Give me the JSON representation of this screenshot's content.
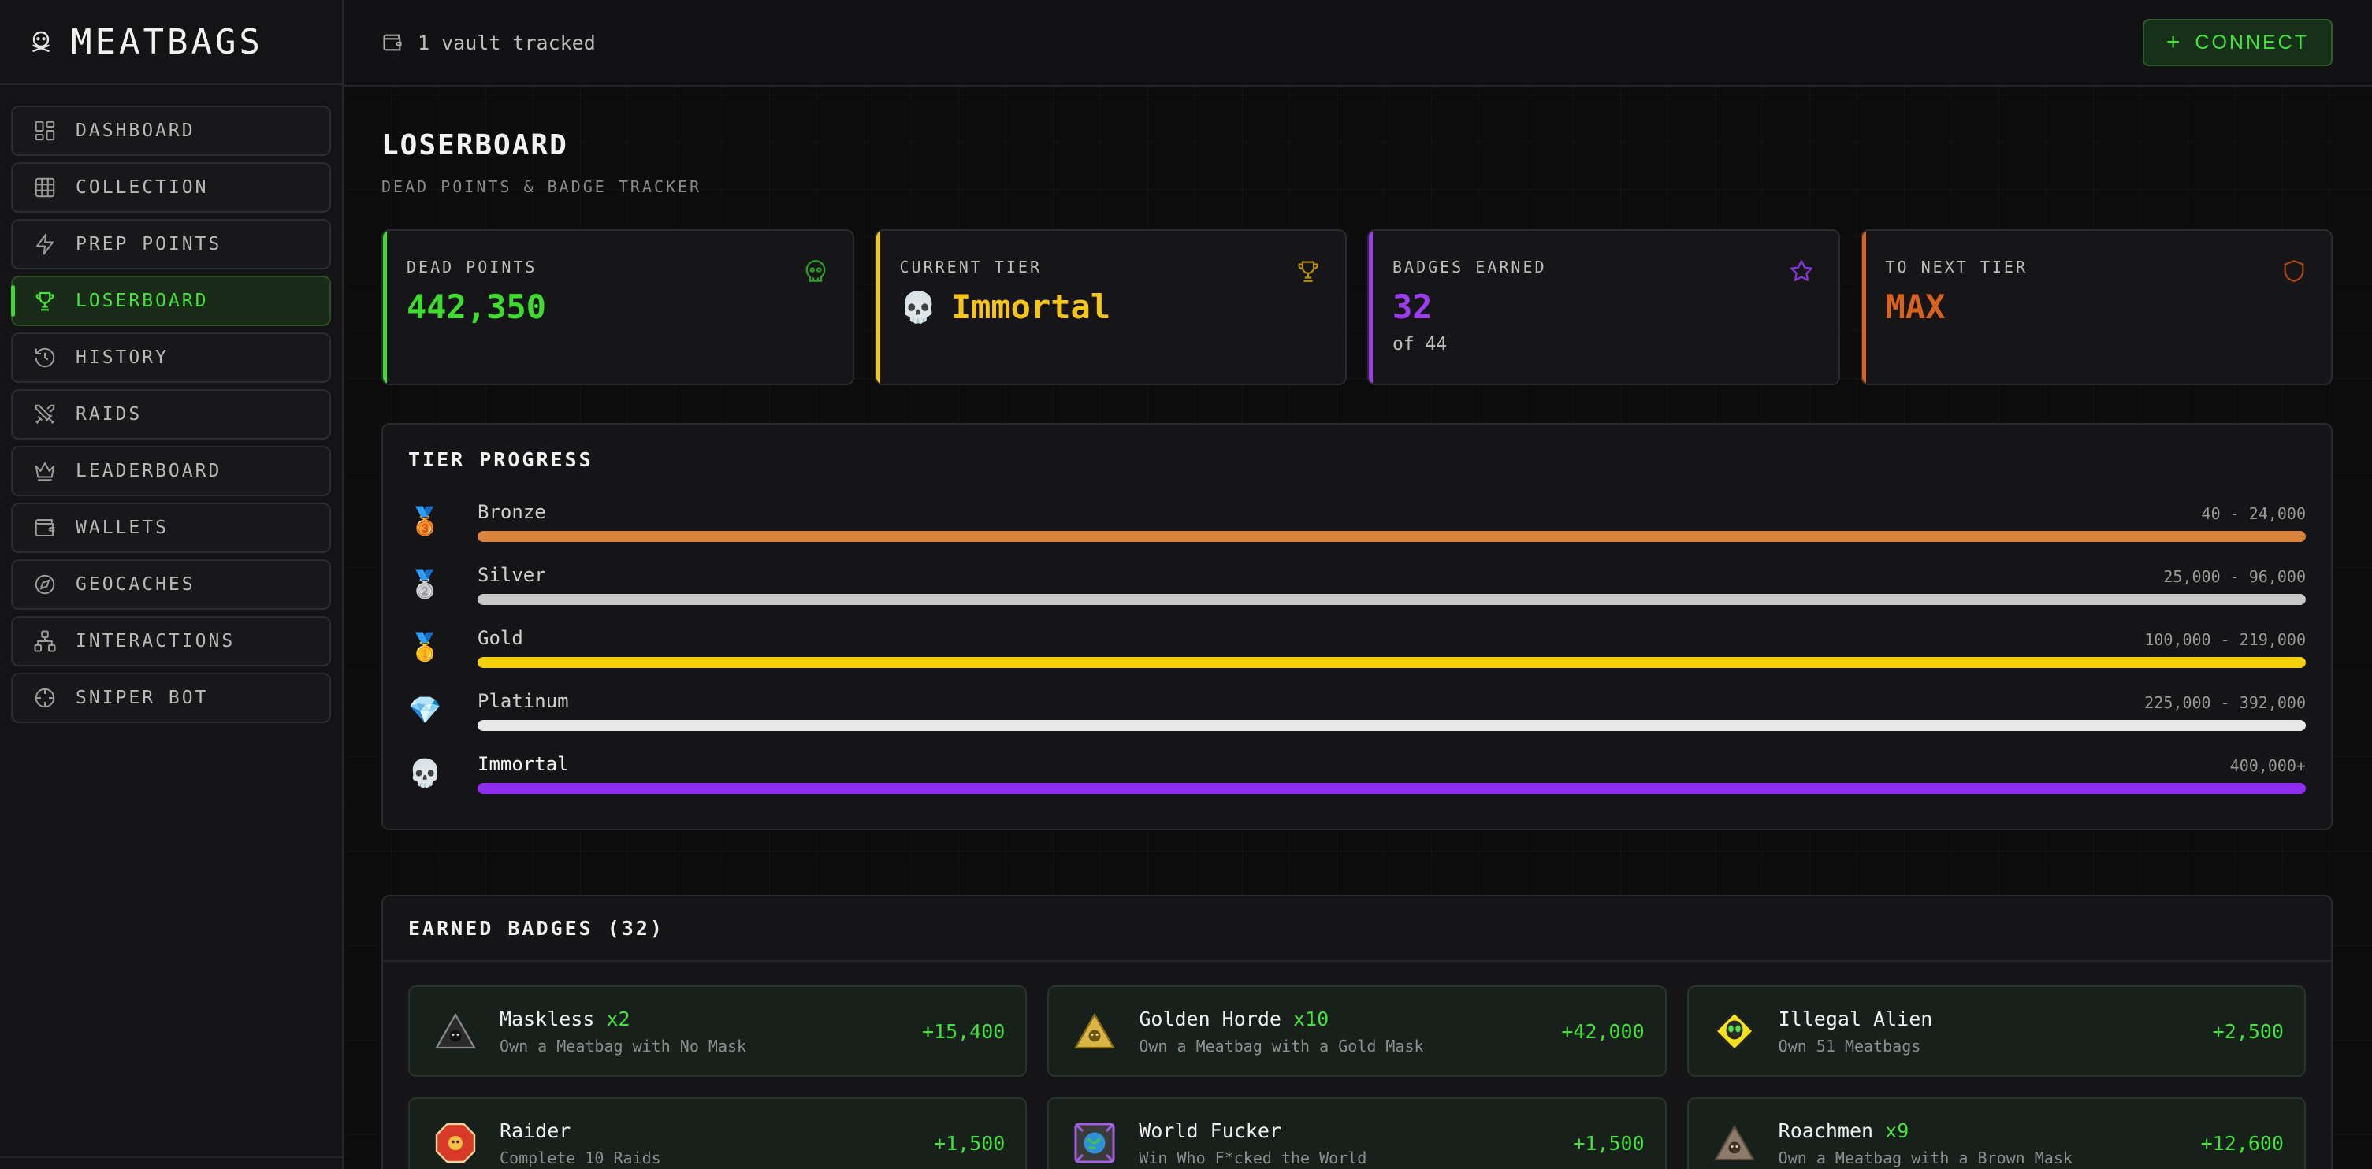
{
  "brand": {
    "name": "MEATBAGS"
  },
  "nav": [
    {
      "label": "DASHBOARD",
      "icon": "dashboard-icon"
    },
    {
      "label": "COLLECTION",
      "icon": "grid-icon"
    },
    {
      "label": "PREP POINTS",
      "icon": "lightning-icon"
    },
    {
      "label": "LOSERBOARD",
      "icon": "trophy-icon",
      "active": true
    },
    {
      "label": "HISTORY",
      "icon": "history-icon"
    },
    {
      "label": "RAIDS",
      "icon": "swords-icon"
    },
    {
      "label": "LEADERBOARD",
      "icon": "crown-icon"
    },
    {
      "label": "WALLETS",
      "icon": "wallet-icon"
    },
    {
      "label": "GEOCACHES",
      "icon": "compass-icon"
    },
    {
      "label": "INTERACTIONS",
      "icon": "network-icon"
    },
    {
      "label": "SNIPER BOT",
      "icon": "crosshair-icon"
    }
  ],
  "topbar": {
    "vault_text": "1 vault tracked",
    "connect_plus": "+",
    "connect_label": "CONNECT"
  },
  "page": {
    "title": "LOSERBOARD",
    "subtitle": "DEAD POINTS & BADGE TRACKER"
  },
  "stats": {
    "dead_points": {
      "label": "DEAD POINTS",
      "value": "442,350",
      "accent": "#3ddc2f"
    },
    "current_tier": {
      "label": "CURRENT TIER",
      "emoji": "💀",
      "value": "Immortal",
      "accent": "#f5c518"
    },
    "badges_earned": {
      "label": "BADGES EARNED",
      "value": "32",
      "sub": "of 44",
      "accent": "#9b3cf0"
    },
    "to_next_tier": {
      "label": "TO NEXT TIER",
      "value": "MAX",
      "accent": "#d9621f"
    }
  },
  "tier_progress": {
    "title": "TIER PROGRESS",
    "tiers": [
      {
        "emoji": "🥉",
        "name": "Bronze",
        "range": "40 - 24,000",
        "color": "#d9843a",
        "progress": 1
      },
      {
        "emoji": "🥈",
        "name": "Silver",
        "range": "25,000 - 96,000",
        "color": "#c8c8c8",
        "progress": 1
      },
      {
        "emoji": "🥇",
        "name": "Gold",
        "range": "100,000 - 219,000",
        "color": "#f6cf0b",
        "progress": 1
      },
      {
        "emoji": "💎",
        "name": "Platinum",
        "range": "225,000 - 392,000",
        "color": "#e8e8e8",
        "progress": 1
      },
      {
        "emoji": "💀",
        "name": "Immortal",
        "range": "400,000+",
        "color": "#8f2ef0",
        "progress": 1
      }
    ]
  },
  "earned_badges": {
    "title": "EARNED BADGES (32)",
    "items": [
      {
        "name": "Maskless",
        "mult": "x2",
        "desc": "Own a Meatbag with No Mask",
        "points": "+15,400",
        "icon": "maskless-badge-icon"
      },
      {
        "name": "Golden Horde",
        "mult": "x10",
        "desc": "Own a Meatbag with a Gold Mask",
        "points": "+42,000",
        "icon": "golden-horde-badge-icon"
      },
      {
        "name": "Illegal Alien",
        "mult": "",
        "desc": "Own 51 Meatbags",
        "points": "+2,500",
        "icon": "alien-badge-icon"
      },
      {
        "name": "Raider",
        "mult": "",
        "desc": "Complete 10 Raids",
        "points": "+1,500",
        "icon": "raider-badge-icon"
      },
      {
        "name": "World Fucker",
        "mult": "",
        "desc": "Win Who F*cked the World",
        "points": "+1,500",
        "icon": "world-badge-icon"
      },
      {
        "name": "Roachmen",
        "mult": "x9",
        "desc": "Own a Meatbag with a Brown Mask",
        "points": "+12,600",
        "icon": "roachmen-badge-icon"
      }
    ]
  }
}
